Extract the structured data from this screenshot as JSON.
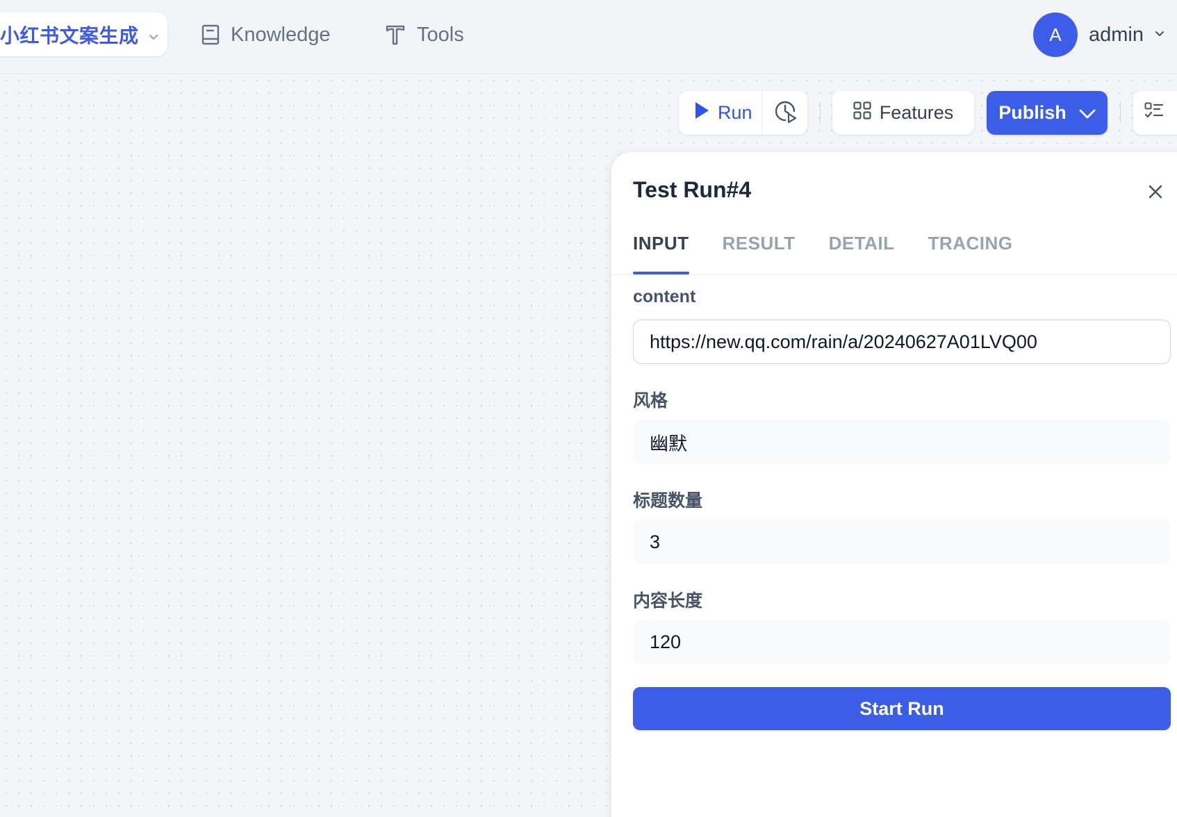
{
  "header": {
    "app_name": "小红书文案生成",
    "nav": [
      {
        "label": "Knowledge",
        "icon": "book-icon"
      },
      {
        "label": "Tools",
        "icon": "hammer-icon"
      }
    ],
    "user": {
      "initial": "A",
      "name": "admin"
    }
  },
  "toolbar": {
    "run_label": "Run",
    "features_label": "Features",
    "publish_label": "Publish"
  },
  "panel": {
    "title": "Test Run#4",
    "tabs": [
      "INPUT",
      "RESULT",
      "DETAIL",
      "TRACING"
    ],
    "active_tab": "INPUT",
    "fields": [
      {
        "label": "content",
        "value": "https://new.qq.com/rain/a/20240627A01LVQ00"
      },
      {
        "label": "风格",
        "value": "幽默"
      },
      {
        "label": "标题数量",
        "value": "3"
      },
      {
        "label": "内容长度",
        "value": "120"
      }
    ],
    "start_label": "Start Run"
  },
  "colors": {
    "primary": "#3b5de7",
    "canvas": "#f3f5f9",
    "muted_text": "#98a2b3"
  }
}
